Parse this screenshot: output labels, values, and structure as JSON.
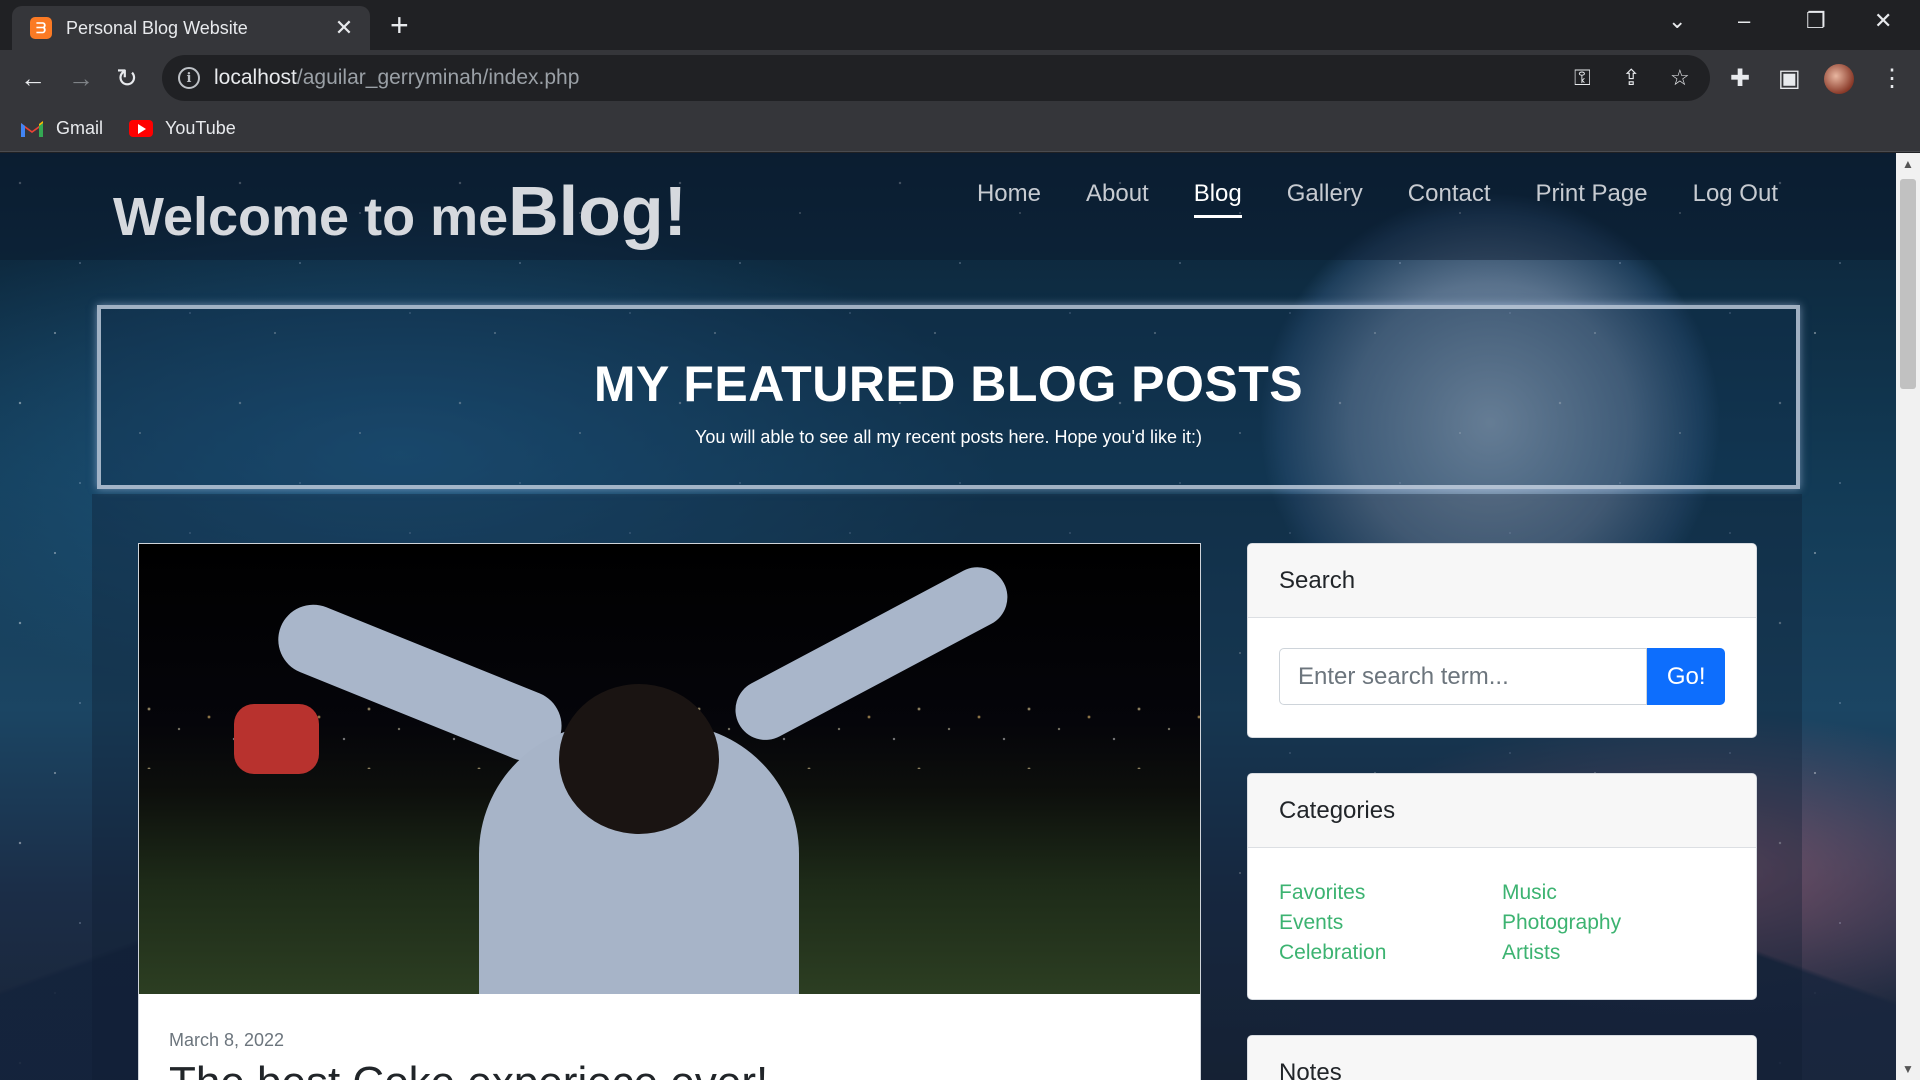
{
  "browser": {
    "tab_title": "Personal Blog Website",
    "url_host": "localhost",
    "url_path": "/aguilar_gerryminah/index.php",
    "bookmarks": [
      {
        "label": "Gmail"
      },
      {
        "label": "YouTube"
      }
    ]
  },
  "site": {
    "logo_prefix": "Welcome to me",
    "logo_highlight": "Blog!",
    "nav": [
      {
        "label": "Home"
      },
      {
        "label": "About"
      },
      {
        "label": "Blog",
        "active": true
      },
      {
        "label": "Gallery"
      },
      {
        "label": "Contact"
      },
      {
        "label": "Print Page"
      },
      {
        "label": "Log Out"
      }
    ]
  },
  "feature": {
    "heading": "MY FEATURED BLOG POSTS",
    "subtitle": "You will able to see all my recent posts here. Hope you'd like it:)"
  },
  "post": {
    "date": "March 8, 2022",
    "title": "The best Coke experiece ever!"
  },
  "sidebar": {
    "search": {
      "title": "Search",
      "placeholder": "Enter search term...",
      "button": "Go!"
    },
    "categories": {
      "title": "Categories",
      "left": [
        "Favorites",
        "Events",
        "Celebration"
      ],
      "right": [
        "Music",
        "Photography",
        "Artists"
      ]
    },
    "notes": {
      "title": "Notes"
    }
  },
  "colors": {
    "accent": "#0d6efd",
    "category_link": "#3cb371"
  }
}
